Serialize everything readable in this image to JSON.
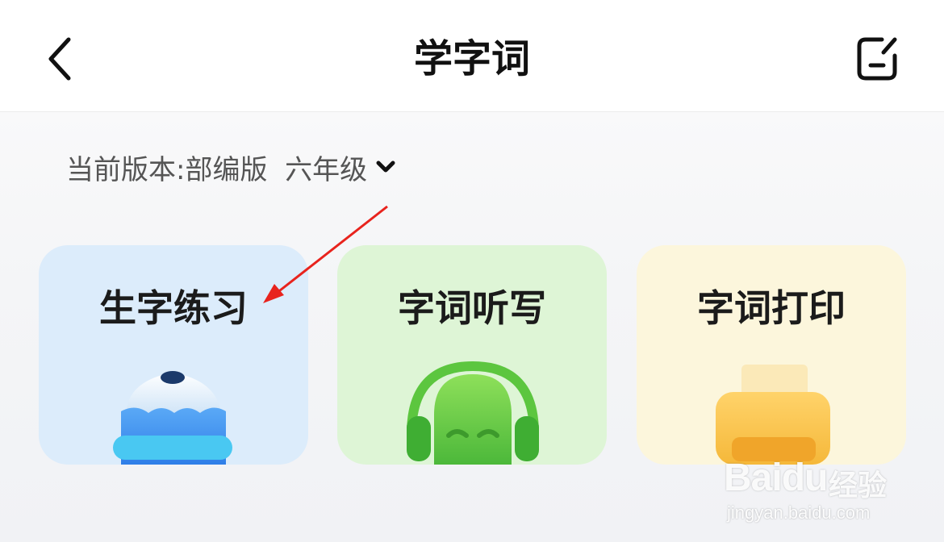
{
  "header": {
    "title": "学字词",
    "back_icon": "chevron-left-icon",
    "edit_icon": "edit-note-icon"
  },
  "version": {
    "label": "当前版本:部编版  六年级",
    "caret_icon": "chevron-down-icon"
  },
  "cards": [
    {
      "label": "生字练习",
      "icon": "pencil-illustration",
      "bg": "#dcecfb"
    },
    {
      "label": "字词听写",
      "icon": "headphones-illustration",
      "bg": "#def5d6"
    },
    {
      "label": "字词打印",
      "icon": "printer-illustration",
      "bg": "#fcf6dc"
    }
  ],
  "watermark": {
    "brand": "Baidu",
    "suffix": "经验",
    "url": "jingyan.baidu.com"
  },
  "colors": {
    "annotation_arrow": "#e8231d"
  }
}
